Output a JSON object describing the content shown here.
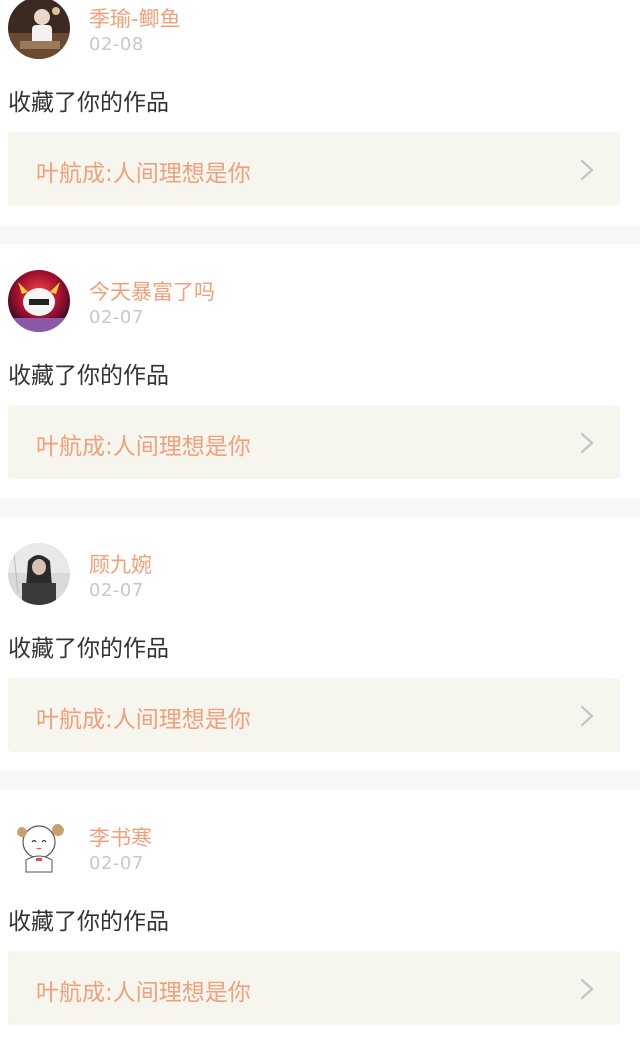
{
  "notifications": [
    {
      "user": "季瑜-鲫鱼",
      "date": "02-08",
      "action": "收藏了你的作品",
      "work": "叶航成:人间理想是你",
      "avatar": "avatar-photo-person-icon"
    },
    {
      "user": "今天暴富了吗",
      "date": "02-07",
      "action": "收藏了你的作品",
      "work": "叶航成:人间理想是你",
      "avatar": "avatar-masked-figure-icon"
    },
    {
      "user": "顾九婉",
      "date": "02-07",
      "action": "收藏了你的作品",
      "work": "叶航成:人间理想是你",
      "avatar": "avatar-girl-photo-icon"
    },
    {
      "user": "李书寒",
      "date": "02-07",
      "action": "收藏了你的作品",
      "work": "叶航成:人间理想是你",
      "avatar": "avatar-cartoon-girl-icon"
    }
  ],
  "colors": {
    "accent": "#f0a07a",
    "date": "#c8c8c8",
    "text": "#333333",
    "card_bg": "#f6f5ee",
    "divider": "#f7f7f7"
  }
}
